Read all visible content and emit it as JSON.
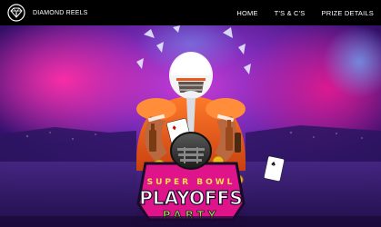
{
  "header": {
    "brand_name": "DIAMOND REELS",
    "nav": [
      {
        "label": "HOME"
      },
      {
        "label": "T'S & C'S"
      },
      {
        "label": "PRIZE DETAILS"
      }
    ]
  },
  "hero": {
    "logo_top_line": "SUPER BOWL",
    "logo_main": "PLAYOFFS",
    "logo_bottom": "PARTY"
  },
  "colors": {
    "accent_pink": "#e0148a",
    "background_purple": "#3a1270",
    "jersey_orange": "#e8571e",
    "logo_green": "#7fd14b"
  },
  "icons": {
    "brand_logo": "diamond-icon"
  }
}
